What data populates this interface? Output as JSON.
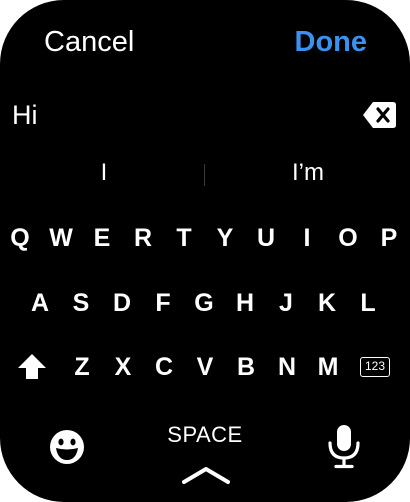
{
  "header": {
    "cancel_label": "Cancel",
    "done_label": "Done"
  },
  "input": {
    "text": "Hi"
  },
  "suggestions": [
    "I",
    "I’m"
  ],
  "keyboard": {
    "row1": [
      "Q",
      "W",
      "E",
      "R",
      "T",
      "Y",
      "U",
      "I",
      "O",
      "P"
    ],
    "row2": [
      "A",
      "S",
      "D",
      "F",
      "G",
      "H",
      "J",
      "K",
      "L"
    ],
    "row3": [
      "Z",
      "X",
      "C",
      "V",
      "B",
      "N",
      "M"
    ],
    "numbers_label": "123",
    "space_label": "SPACE"
  },
  "icons": {
    "backspace": "backspace-icon",
    "shift": "shift-arrow-icon",
    "emoji": "smiley-emoji-icon",
    "microphone": "microphone-icon",
    "expand": "chevron-up-icon"
  },
  "colors": {
    "background": "#000000",
    "accent": "#3b91f0",
    "text": "#ffffff"
  }
}
